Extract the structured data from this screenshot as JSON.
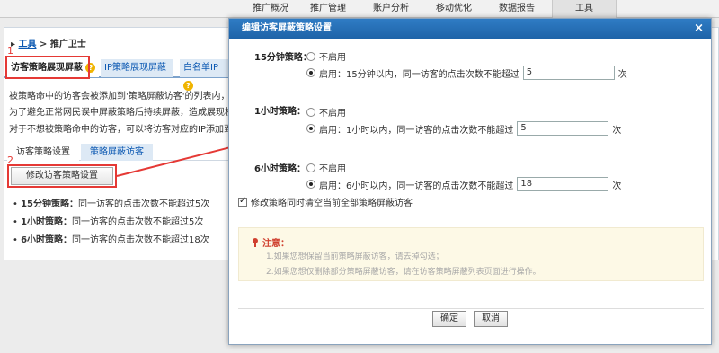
{
  "topnav": {
    "tabs": [
      "推广概况",
      "推广管理",
      "账户分析",
      "移动优化",
      "数据报告",
      "工具"
    ],
    "active": "工具"
  },
  "breadcrumb": {
    "link": "工具",
    "sep": ">",
    "current": "推广卫士"
  },
  "bg_tabs": {
    "tab1": "访客策略展现屏蔽",
    "tab2": "IP策略展现屏蔽",
    "tab3": "白名单IP"
  },
  "annotations": {
    "num1": "1",
    "num2": "2"
  },
  "desc": [
    "被策略命中的访客会被添加到'策略屏蔽访客'的列表内，将对",
    "为了避免正常网民误中屏蔽策略后持续屏蔽，造成展现机会损",
    "对于不想被策略命中的访客，可以将访客对应的IP添加到'白"
  ],
  "sub_tabs": {
    "tab1": "访客策略设置",
    "tab2": "策略屏蔽访客"
  },
  "modify_button": "修改访客策略设置",
  "rules": [
    {
      "label": "15分钟策略：",
      "text": "同一访客的点击次数不能超过5次"
    },
    {
      "label": "1小时策略：",
      "text": "同一访客的点击次数不能超过5次"
    },
    {
      "label": "6小时策略：",
      "text": "同一访客的点击次数不能超过18次"
    }
  ],
  "modal": {
    "title": "编辑访客屏蔽策略设置",
    "close": "×",
    "policies": [
      {
        "label": "15分钟策略：",
        "off": "不启用",
        "on_prefix": "启用：15分钟以内，同一访客的点击次数不能超过",
        "value": "5",
        "unit": "次"
      },
      {
        "label": "1小时策略：",
        "off": "不启用",
        "on_prefix": "启用：1小时以内，同一访客的点击次数不能超过",
        "value": "5",
        "unit": "次"
      },
      {
        "label": "6小时策略：",
        "off": "不启用",
        "on_prefix": "启用：6小时以内，同一访客的点击次数不能超过",
        "value": "18",
        "unit": "次"
      }
    ],
    "checkbox_label": "修改策略同时清空当前全部策略屏蔽访客",
    "notice_title": "注意：",
    "notice_lines": [
      "1.如果您想保留当前策略屏蔽访客，请去掉勾选；",
      "2.如果您想仅删除部分策略屏蔽访客，请在访客策略屏蔽列表页面进行操作。"
    ],
    "ok": "确定",
    "cancel": "取消"
  },
  "colors": {
    "accent": "#1e63a8",
    "annotation": "#e53935",
    "notice_bg": "#fdf9e6"
  }
}
